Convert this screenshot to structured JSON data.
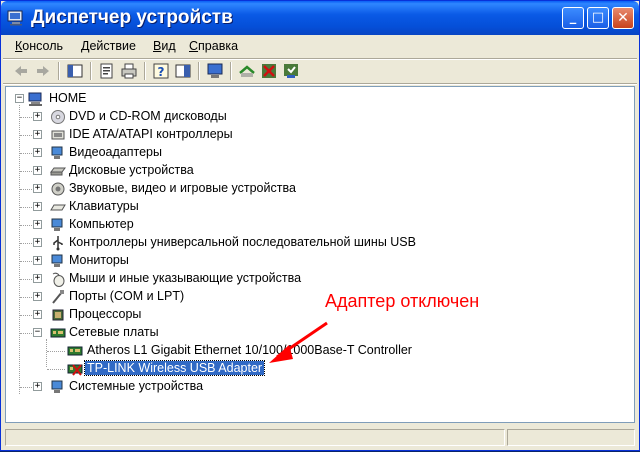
{
  "window": {
    "title": "Диспетчер устройств",
    "buttons": {
      "minimize": "_",
      "maximize": "□",
      "close": "✕"
    }
  },
  "menu": [
    {
      "label": "Консоль",
      "hotkey_index": 0
    },
    {
      "label": "Действие",
      "hotkey_index": 0
    },
    {
      "label": "Вид",
      "hotkey_index": 0
    },
    {
      "label": "Справка",
      "hotkey_index": 0
    }
  ],
  "toolbar": {
    "icons": [
      "back-arrow-icon",
      "forward-arrow-icon",
      "console-tree-icon",
      "properties-icon",
      "print-icon",
      "help-icon",
      "view-icon",
      "computer-scan-icon",
      "update-driver-icon",
      "disable-device-icon",
      "uninstall-icon"
    ]
  },
  "tree": {
    "root": "HOME",
    "items": [
      {
        "label": "DVD и CD-ROM дисководы",
        "icon": "cdrom-icon"
      },
      {
        "label": "IDE ATA/ATAPI контроллеры",
        "icon": "ide-controller-icon"
      },
      {
        "label": "Видеоадаптеры",
        "icon": "display-adapter-icon"
      },
      {
        "label": "Дисковые устройства",
        "icon": "disk-drive-icon"
      },
      {
        "label": "Звуковые, видео и игровые устройства",
        "icon": "sound-icon"
      },
      {
        "label": "Клавиатуры",
        "icon": "keyboard-icon"
      },
      {
        "label": "Компьютер",
        "icon": "computer-icon"
      },
      {
        "label": "Контроллеры универсальной последовательной шины USB",
        "icon": "usb-icon"
      },
      {
        "label": "Мониторы",
        "icon": "monitor-icon"
      },
      {
        "label": "Мыши и иные указывающие устройства",
        "icon": "mouse-icon"
      },
      {
        "label": "Порты (COM и LPT)",
        "icon": "port-icon"
      },
      {
        "label": "Процессоры",
        "icon": "processor-icon"
      },
      {
        "label": "Сетевые платы",
        "icon": "network-card-icon",
        "expanded": true,
        "children": [
          {
            "label": "Atheros L1 Gigabit Ethernet 10/100/1000Base-T Controller",
            "icon": "network-adapter-icon"
          },
          {
            "label": "TP-LINK Wireless USB Adapter",
            "icon": "network-adapter-disabled-icon",
            "selected": true,
            "disabled": true
          }
        ]
      },
      {
        "label": "Системные устройства",
        "icon": "system-device-icon"
      }
    ]
  },
  "annotation": {
    "text": "Адаптер отключен",
    "color": "#ff0000"
  },
  "colors": {
    "titlebar": "#0a5ae6",
    "selection": "#316ac5",
    "annotation": "#ff0000"
  }
}
